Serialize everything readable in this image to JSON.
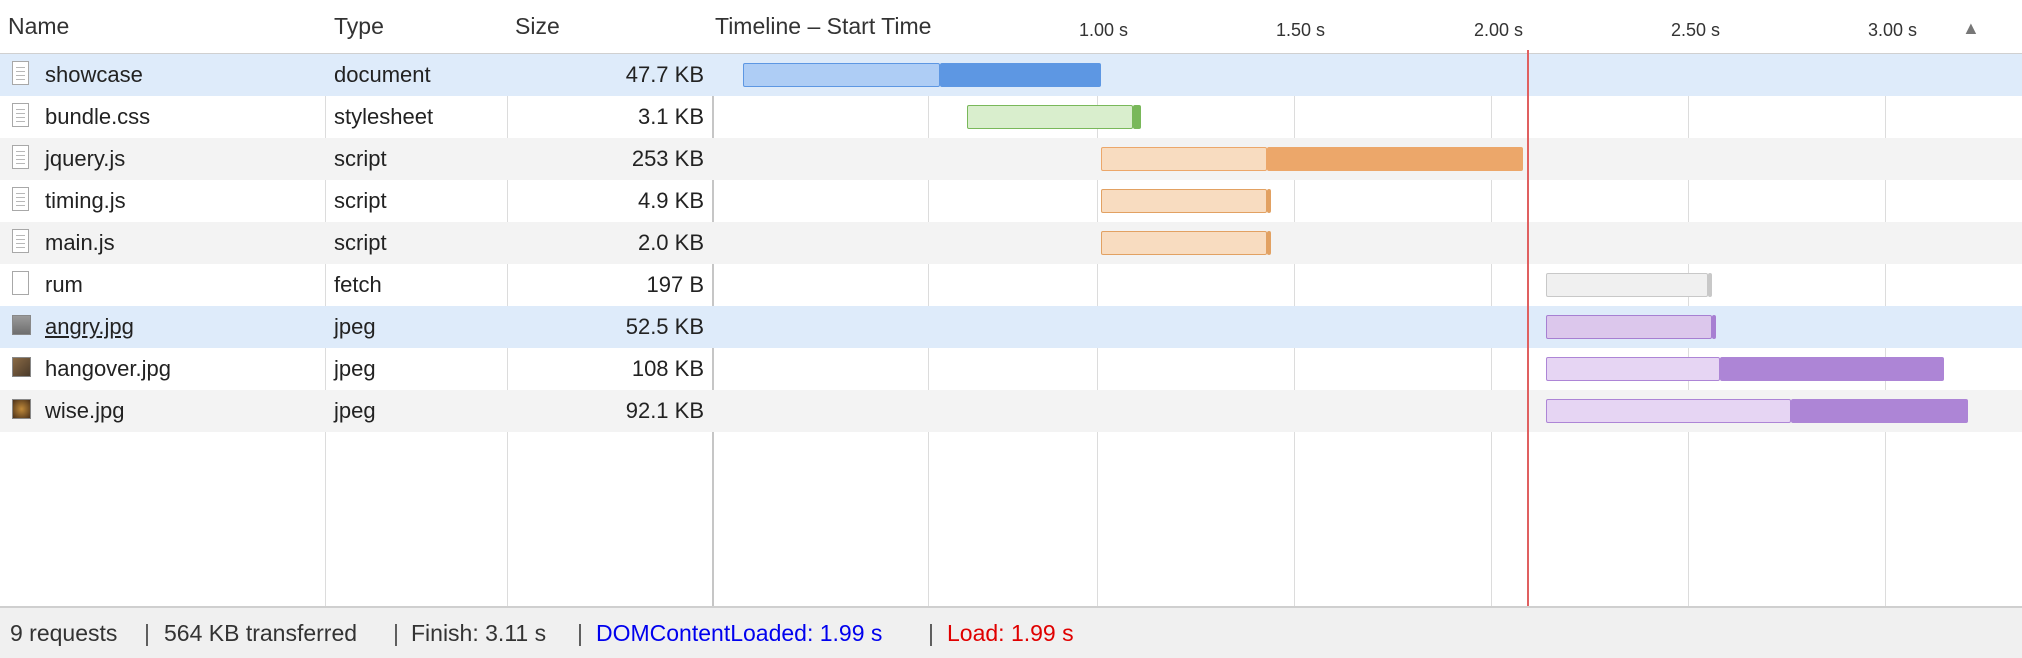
{
  "header": {
    "name": "Name",
    "type": "Type",
    "size": "Size",
    "timeline": "Timeline – Start Time",
    "ticks": [
      "1.00 s",
      "1.50 s",
      "2.00 s",
      "2.50 s",
      "3.00 s"
    ]
  },
  "rows": [
    {
      "name": "showcase",
      "type": "document",
      "size": "47.7 KB",
      "icon": "document-icon"
    },
    {
      "name": "bundle.css",
      "type": "stylesheet",
      "size": "3.1 KB",
      "icon": "document-icon"
    },
    {
      "name": "jquery.js",
      "type": "script",
      "size": "253 KB",
      "icon": "document-icon"
    },
    {
      "name": "timing.js",
      "type": "script",
      "size": "4.9 KB",
      "icon": "document-icon"
    },
    {
      "name": "main.js",
      "type": "script",
      "size": "2.0 KB",
      "icon": "document-icon"
    },
    {
      "name": "rum",
      "type": "fetch",
      "size": "197 B",
      "icon": "blank-document-icon"
    },
    {
      "name": "angry.jpg",
      "type": "jpeg",
      "size": "52.5 KB",
      "icon": "image-thumbnail-icon"
    },
    {
      "name": "hangover.jpg",
      "type": "jpeg",
      "size": "108 KB",
      "icon": "image-thumbnail-icon"
    },
    {
      "name": "wise.jpg",
      "type": "jpeg",
      "size": "92.1 KB",
      "icon": "image-thumbnail-icon"
    }
  ],
  "timeline_bars": [
    {
      "start": 0.07,
      "receive": 0.57,
      "end": 0.98,
      "light": "#aecdf5",
      "dark": "#5d97e3"
    },
    {
      "start": 0.64,
      "receive": 1.06,
      "end": 1.08,
      "light": "#d9eecd",
      "dark": "#79b85a"
    },
    {
      "start": 0.98,
      "receive": 1.4,
      "end": 2.05,
      "light": "#f8dcc0",
      "dark": "#eca76a"
    },
    {
      "start": 0.98,
      "receive": 1.4,
      "end": 1.41,
      "light": "#f8dcc0",
      "dark": "#e2a162"
    },
    {
      "start": 0.98,
      "receive": 1.4,
      "end": 1.41,
      "light": "#f8dcc0",
      "dark": "#e2a162"
    },
    {
      "start": 2.11,
      "receive": 2.52,
      "end": 2.53,
      "light": "#f0f0f0",
      "dark": "#c8c8c8"
    },
    {
      "start": 2.11,
      "receive": 2.53,
      "end": 2.54,
      "light": "#dcc7ec",
      "dark": "#a77fd2"
    },
    {
      "start": 2.11,
      "receive": 2.55,
      "end": 3.12,
      "light": "#e6d5f3",
      "dark": "#ad85d6"
    },
    {
      "start": 2.11,
      "receive": 2.73,
      "end": 3.18,
      "light": "#e6d5f3",
      "dark": "#ad85d6"
    }
  ],
  "footer": {
    "requests": "9 requests",
    "transferred": "564 KB transferred",
    "finish": "Finish: 3.11 s",
    "dcl": "DOMContentLoaded: 1.99 s",
    "load": "Load: 1.99 s",
    "dcl_color": "#0000ee",
    "load_color": "#e00000"
  }
}
